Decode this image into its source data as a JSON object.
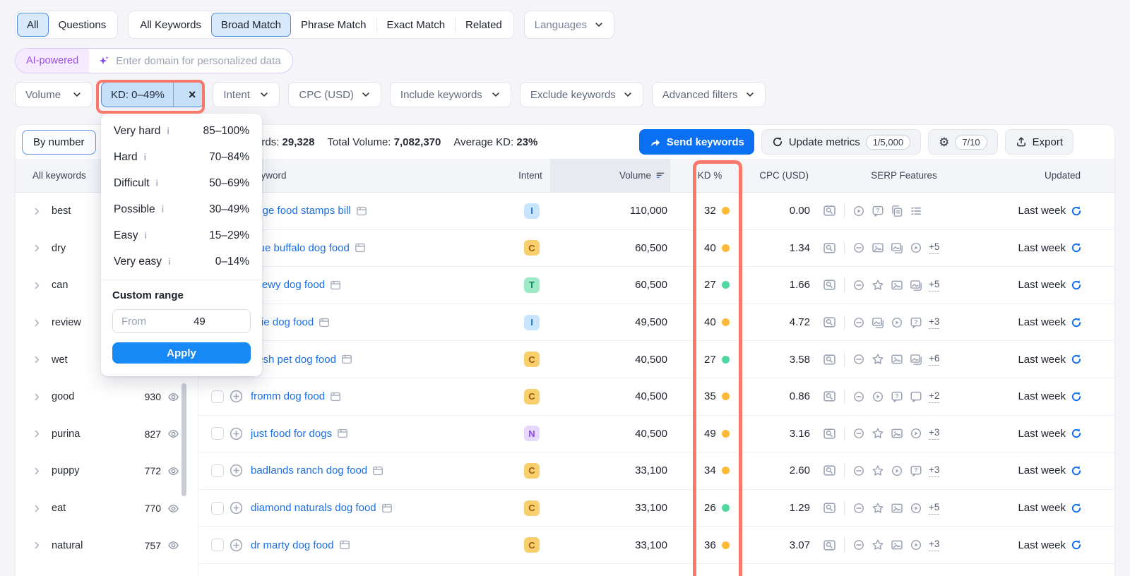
{
  "header_tabs": {
    "groups": [
      {
        "items": [
          {
            "label": "All",
            "selected": true
          },
          {
            "label": "Questions",
            "selected": false
          }
        ]
      },
      {
        "items": [
          {
            "label": "All Keywords",
            "selected": false
          },
          {
            "label": "Broad Match",
            "selected": true
          },
          {
            "label": "Phrase Match",
            "selected": false
          },
          {
            "label": "Exact Match",
            "selected": false
          },
          {
            "label": "Related",
            "selected": false
          }
        ]
      }
    ],
    "languages_label": "Languages"
  },
  "ai_bar": {
    "badge": "AI-powered",
    "placeholder": "Enter domain for personalized data"
  },
  "filter_bar": {
    "chips": [
      {
        "label": "Volume",
        "type": "dropdown"
      },
      {
        "label": "KD: 0–49%",
        "type": "selected",
        "close": "×"
      },
      {
        "label": "Intent",
        "type": "dropdown"
      },
      {
        "label": "CPC (USD)",
        "type": "dropdown"
      },
      {
        "label": "Include keywords",
        "type": "dropdown"
      },
      {
        "label": "Exclude keywords",
        "type": "dropdown"
      },
      {
        "label": "Advanced filters",
        "type": "dropdown"
      }
    ]
  },
  "kd_dropdown": {
    "ranges": [
      {
        "label": "Very hard",
        "range": "85–100%"
      },
      {
        "label": "Hard",
        "range": "70–84%"
      },
      {
        "label": "Difficult",
        "range": "50–69%"
      },
      {
        "label": "Possible",
        "range": "30–49%"
      },
      {
        "label": "Easy",
        "range": "15–29%"
      },
      {
        "label": "Very easy",
        "range": "0–14%"
      }
    ],
    "custom_range_title": "Custom range",
    "from_placeholder": "From",
    "to_value": "49",
    "apply_label": "Apply"
  },
  "toolbar": {
    "by_number_label": "By number",
    "stats": [
      {
        "label": "All keywords:",
        "value": "29,328"
      },
      {
        "label": "Total Volume:",
        "value": "7,082,370"
      },
      {
        "label": "Average KD:",
        "value": "23%"
      }
    ],
    "send_keywords_label": "Send keywords",
    "update_metrics_label": "Update metrics",
    "update_metrics_badge": "1/5,000",
    "settings_badge": "7/10",
    "export_label": "Export"
  },
  "sidebar": {
    "header": "All keywords",
    "items": [
      {
        "label": "best",
        "count": null
      },
      {
        "label": "dry",
        "count": null
      },
      {
        "label": "can",
        "count": null
      },
      {
        "label": "review",
        "count": null
      },
      {
        "label": "wet",
        "count": null
      },
      {
        "label": "good",
        "count": "930"
      },
      {
        "label": "purina",
        "count": "827"
      },
      {
        "label": "puppy",
        "count": "772"
      },
      {
        "label": "eat",
        "count": "770"
      },
      {
        "label": "natural",
        "count": "757"
      }
    ]
  },
  "table": {
    "headers": {
      "keyword": "Keyword",
      "intent": "Intent",
      "volume": "Volume",
      "kd": "KD %",
      "cpc": "CPC (USD)",
      "serp": "SERP Features",
      "updated": "Updated"
    },
    "rows": [
      {
        "keyword": "doge food stamps bill",
        "intent": "I",
        "volume": "110,000",
        "kd": "32",
        "kd_level": "medium",
        "cpc": "0.00",
        "serp_icons": [
          "play",
          "question",
          "copy",
          "list"
        ],
        "serp_more": null,
        "updated": "Last week"
      },
      {
        "keyword": "blue buffalo dog food",
        "intent": "C",
        "volume": "60,500",
        "kd": "40",
        "kd_level": "medium",
        "cpc": "1.34",
        "serp_icons": [
          "link",
          "image",
          "image-stack",
          "play"
        ],
        "serp_more": "+5",
        "updated": "Last week"
      },
      {
        "keyword": "chewy dog food",
        "intent": "T",
        "volume": "60,500",
        "kd": "27",
        "kd_level": "easy",
        "cpc": "1.66",
        "serp_icons": [
          "link",
          "star",
          "image",
          "image-stack"
        ],
        "serp_more": "+5",
        "updated": "Last week"
      },
      {
        "keyword": "ollie dog food",
        "intent": "I",
        "volume": "49,500",
        "kd": "40",
        "kd_level": "medium",
        "cpc": "4.72",
        "serp_icons": [
          "link",
          "image-stack",
          "play",
          "question"
        ],
        "serp_more": "+3",
        "updated": "Last week"
      },
      {
        "keyword": "fresh pet dog food",
        "intent": "C",
        "volume": "40,500",
        "kd": "27",
        "kd_level": "easy",
        "cpc": "3.58",
        "serp_icons": [
          "link",
          "star",
          "image",
          "image-stack"
        ],
        "serp_more": "+6",
        "updated": "Last week"
      },
      {
        "keyword": "fromm dog food",
        "intent": "C",
        "volume": "40,500",
        "kd": "35",
        "kd_level": "medium",
        "cpc": "0.86",
        "serp_icons": [
          "link",
          "play",
          "question",
          "comment"
        ],
        "serp_more": "+2",
        "updated": "Last week"
      },
      {
        "keyword": "just food for dogs",
        "intent": "N",
        "volume": "40,500",
        "kd": "49",
        "kd_level": "medium",
        "cpc": "3.16",
        "serp_icons": [
          "link",
          "star",
          "image",
          "play"
        ],
        "serp_more": "+3",
        "updated": "Last week"
      },
      {
        "keyword": "badlands ranch dog food",
        "intent": "C",
        "volume": "33,100",
        "kd": "34",
        "kd_level": "medium",
        "cpc": "2.60",
        "serp_icons": [
          "link",
          "star",
          "play",
          "question"
        ],
        "serp_more": "+3",
        "updated": "Last week"
      },
      {
        "keyword": "diamond naturals dog food",
        "intent": "C",
        "volume": "33,100",
        "kd": "26",
        "kd_level": "easy",
        "cpc": "1.29",
        "serp_icons": [
          "link",
          "star",
          "image",
          "play"
        ],
        "serp_more": "+5",
        "updated": "Last week"
      },
      {
        "keyword": "dr marty dog food",
        "intent": "C",
        "volume": "33,100",
        "kd": "36",
        "kd_level": "medium",
        "cpc": "3.07",
        "serp_icons": [
          "link",
          "star",
          "image",
          "play"
        ],
        "serp_more": "+3",
        "updated": "Last week"
      }
    ]
  },
  "legend": {
    "intent_styles": {
      "I": {
        "bg": "#C9E5FE",
        "fg": "#1B76D2"
      },
      "C": {
        "bg": "#F8CF6D",
        "fg": "#9A5C07"
      },
      "T": {
        "bg": "#9FEAC6",
        "fg": "#0C8A61"
      },
      "N": {
        "bg": "#E7D8FE",
        "fg": "#8A4BE8"
      }
    },
    "kd_colors": {
      "easy": "#4FD7A2",
      "medium": "#FFB938"
    }
  },
  "colors": {
    "accent_blue": "#0A6FF0",
    "annotation_red": "#F8796C",
    "link_blue": "#1B6FE6"
  }
}
